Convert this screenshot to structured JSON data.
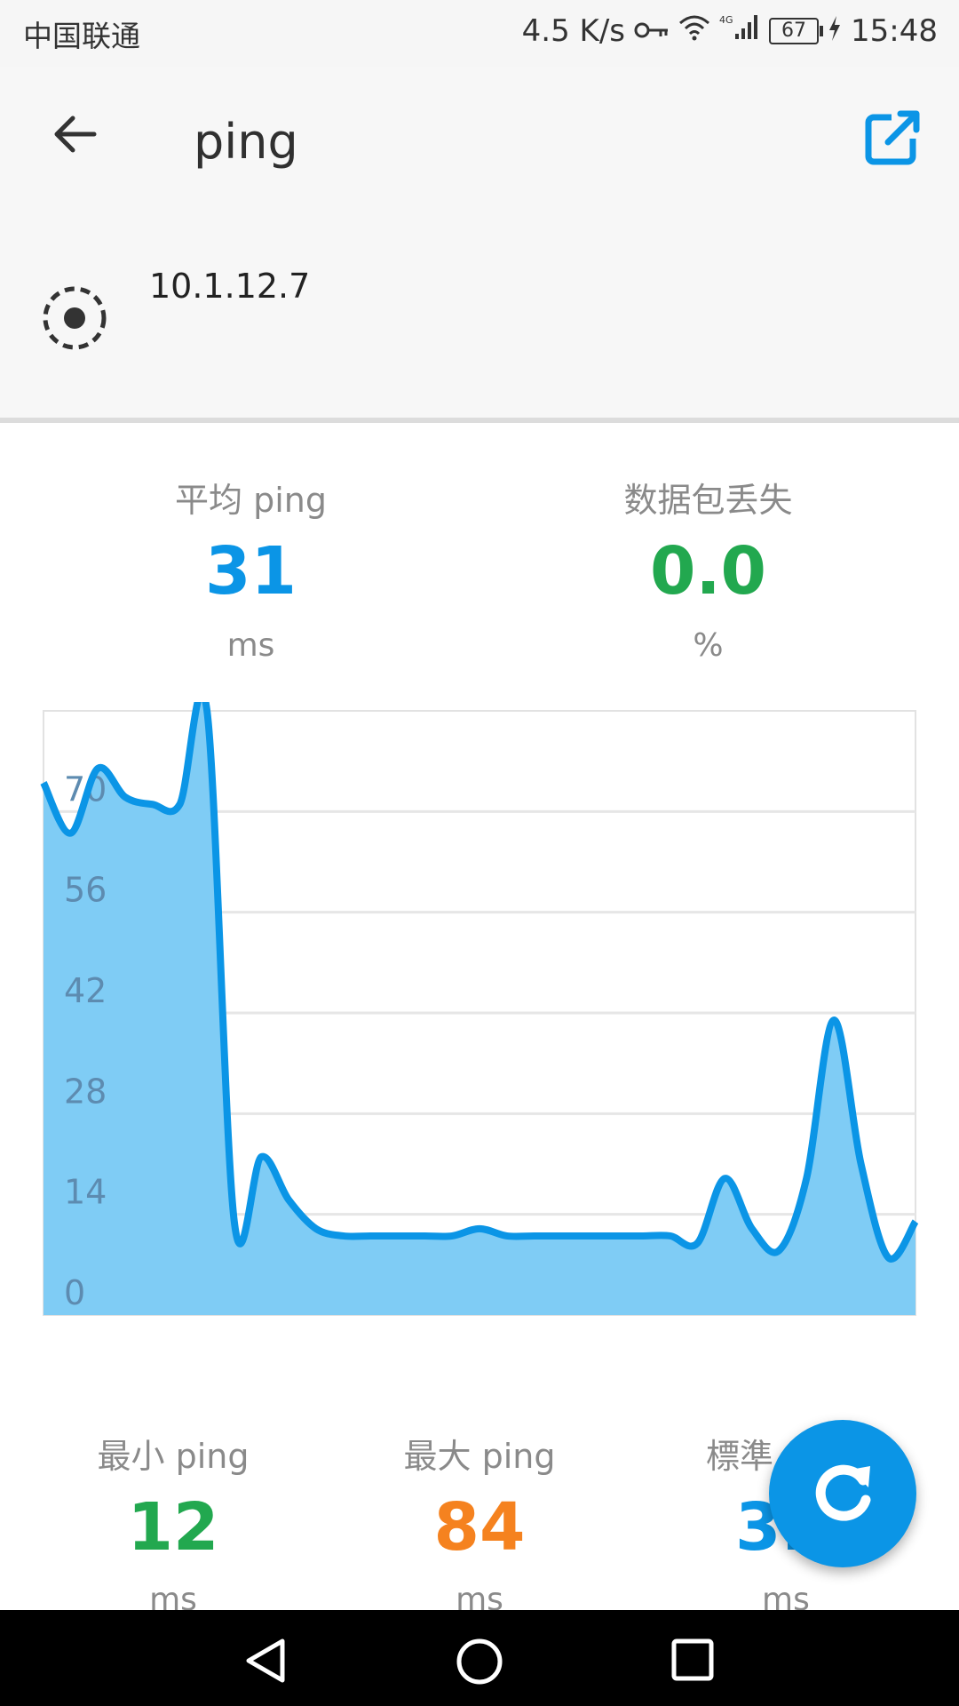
{
  "status_bar": {
    "carrier": "中国联通",
    "net_speed": "4.5 K/s",
    "battery": "67",
    "time": "15:48",
    "icons": [
      "key-icon",
      "wifi-icon",
      "signal-4g-icon",
      "battery-icon",
      "charging-icon"
    ]
  },
  "appbar": {
    "title": "ping",
    "host": "10.1.12.7",
    "icons": {
      "back": "back-arrow-icon",
      "share": "open-external-icon",
      "target": "target-icon"
    }
  },
  "stats_top": {
    "avg": {
      "label": "平均 ping",
      "value": "31",
      "unit": "ms"
    },
    "loss": {
      "label": "数据包丢失",
      "value": "0.0",
      "unit": "%"
    }
  },
  "stats_bottom": {
    "min": {
      "label": "最小 ping",
      "value": "12",
      "unit": "ms"
    },
    "max": {
      "label": "最大 ping",
      "value": "84",
      "unit": "ms"
    },
    "std": {
      "label": "標準",
      "value": "3.",
      "unit": "ms"
    }
  },
  "colors": {
    "accent": "#0b95e6",
    "green": "#22a84f",
    "orange": "#f5821f",
    "area_fill": "#7fccf5"
  },
  "chart_data": {
    "type": "area",
    "ylim": [
      0,
      84
    ],
    "yticks": [
      0,
      14,
      28,
      42,
      56,
      70
    ],
    "grid": true,
    "series": [
      {
        "values": [
          74,
          67,
          76,
          72,
          71,
          71,
          84,
          13,
          22,
          16,
          12,
          11,
          11,
          11,
          11,
          11,
          12,
          11,
          11,
          11,
          11,
          11,
          11,
          11,
          10,
          19,
          12,
          9,
          19,
          41,
          21,
          8,
          13
        ]
      }
    ]
  },
  "fab": {
    "icon": "refresh-icon"
  },
  "nav_bar": {
    "icons": [
      "nav-back-icon",
      "nav-home-icon",
      "nav-recent-icon"
    ]
  }
}
